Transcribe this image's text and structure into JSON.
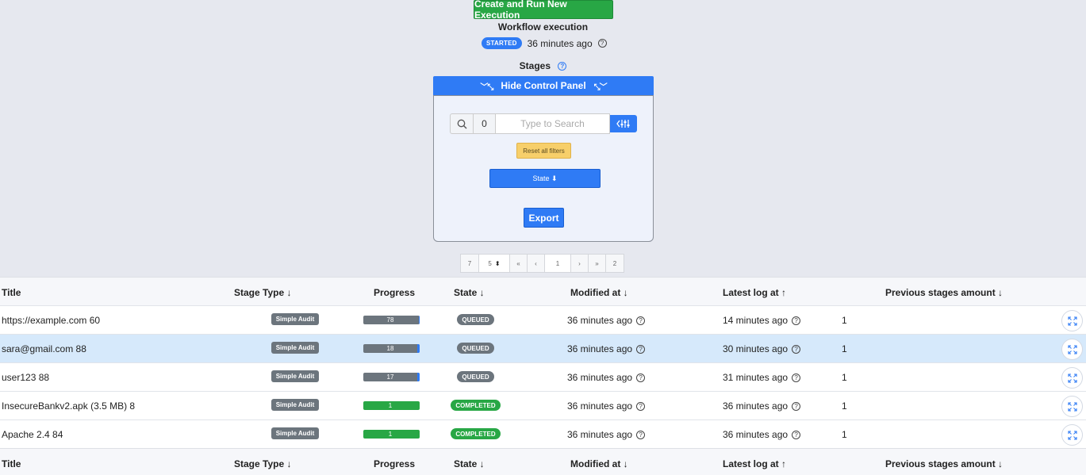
{
  "header": {
    "create_button": "Create and Run New Execution",
    "title": "Workflow execution",
    "status_badge": "STARTED",
    "status_time": "36 minutes ago",
    "stages_label": "Stages"
  },
  "control_panel": {
    "toggle_label": "Hide Control Panel",
    "search_count": "0",
    "search_placeholder": "Type to Search",
    "reset_label": "Reset all filters",
    "state_label": "State ⬇",
    "export_label": "Export"
  },
  "pagination": {
    "total": "7",
    "page_size": "5",
    "first": "«",
    "prev": "‹",
    "current": "1",
    "next": "›",
    "last": "»",
    "pages": "2"
  },
  "table": {
    "columns": {
      "title": "Title",
      "stage_type": "Stage Type ↓",
      "progress": "Progress",
      "state": "State ↓",
      "modified": "Modified at ↓",
      "latest_log": "Latest log at ↑",
      "previous": "Previous stages amount ↓"
    },
    "rows": [
      {
        "title": "https://example.com 60",
        "type": "Simple Audit",
        "progress": "78",
        "progress_fraction": 0.02,
        "state": "QUEUED",
        "modified": "36 minutes ago",
        "latest_log": "14 minutes ago",
        "previous": "1"
      },
      {
        "title": "sara@gmail.com 88",
        "type": "Simple Audit",
        "progress": "18",
        "progress_fraction": 0.04,
        "state": "QUEUED",
        "modified": "36 minutes ago",
        "latest_log": "30 minutes ago",
        "previous": "1"
      },
      {
        "title": "user123 88",
        "type": "Simple Audit",
        "progress": "17",
        "progress_fraction": 0.04,
        "state": "QUEUED",
        "modified": "36 minutes ago",
        "latest_log": "31 minutes ago",
        "previous": "1"
      },
      {
        "title": "InsecureBankv2.apk (3.5 MB) 8",
        "type": "Simple Audit",
        "progress": "1",
        "progress_fraction": 1.0,
        "state": "COMPLETED",
        "modified": "36 minutes ago",
        "latest_log": "36 minutes ago",
        "previous": "1"
      },
      {
        "title": "Apache 2.4 84",
        "type": "Simple Audit",
        "progress": "1",
        "progress_fraction": 1.0,
        "state": "COMPLETED",
        "modified": "36 minutes ago",
        "latest_log": "36 minutes ago",
        "previous": "1"
      }
    ]
  },
  "colors": {
    "primary": "#2f7bf5",
    "success": "#28a745",
    "secondary": "#6c757d",
    "warning": "#f7cf6a",
    "selected_row": "#d6e9fb"
  }
}
